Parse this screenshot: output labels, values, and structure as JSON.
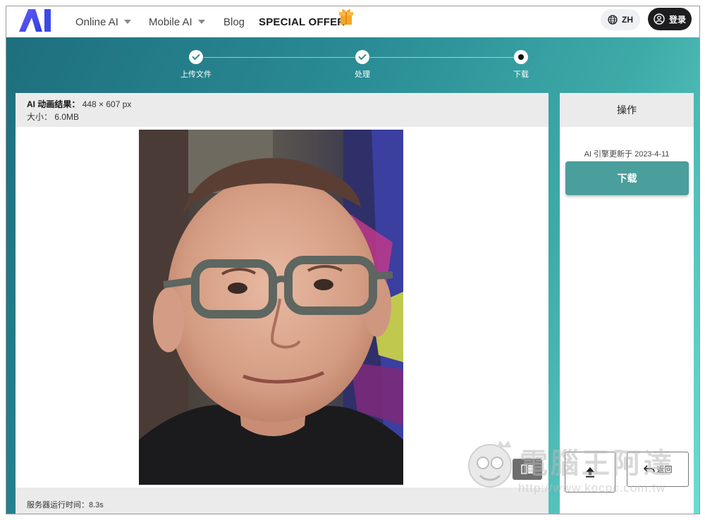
{
  "header": {
    "nav": [
      {
        "label": "Online AI",
        "has_dropdown": true
      },
      {
        "label": "Mobile AI",
        "has_dropdown": true
      },
      {
        "label": "Blog",
        "has_dropdown": false
      },
      {
        "label": "SPECIAL OFFER",
        "has_dropdown": false
      }
    ],
    "lang_label": "ZH",
    "login_label": "登录"
  },
  "stepper": {
    "steps": [
      {
        "label": "上传文件",
        "state": "done"
      },
      {
        "label": "处理",
        "state": "done"
      },
      {
        "label": "下载",
        "state": "current"
      }
    ]
  },
  "result": {
    "title_label": "AI 动画结果：",
    "dimensions": "448 × 607 px",
    "size_label": "大小：",
    "size_value": "6.0MB",
    "server_time": "服务器运行时间：8.3s"
  },
  "operations": {
    "header": "操作",
    "engine_note": "AI 引擎更新于 2023-4-11",
    "download_label": "下载",
    "back_label": "返回"
  },
  "watermark": {
    "text": "電腦王阿達",
    "url": "http://www.kocpc.com.tw"
  },
  "colors": {
    "accent": "#4a9e9c",
    "teal_dark": "#1e6f7e",
    "teal_light": "#6fdcd1",
    "login_bg": "#1d1d1f"
  }
}
